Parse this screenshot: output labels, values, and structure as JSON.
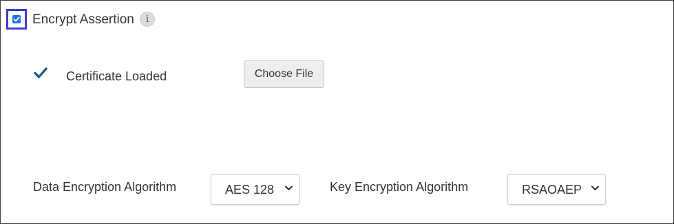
{
  "encrypt_assertion": {
    "label": "Encrypt Assertion",
    "checked": true,
    "info_icon_glyph": "i",
    "info_icon": "info-icon"
  },
  "certificate": {
    "status_icon": "check-icon",
    "status_label": "Certificate Loaded",
    "choose_file_label": "Choose File"
  },
  "data_encryption": {
    "label": "Data Encryption Algorithm",
    "selected": "AES 128"
  },
  "key_encryption": {
    "label": "Key Encryption Algorithm",
    "selected": "RSAOAEP"
  },
  "colors": {
    "checkbox": "#1a73e8",
    "focus_ring": "#3b3bd0",
    "check_mark": "#1f5a8a",
    "border": "#3c3c3c"
  }
}
